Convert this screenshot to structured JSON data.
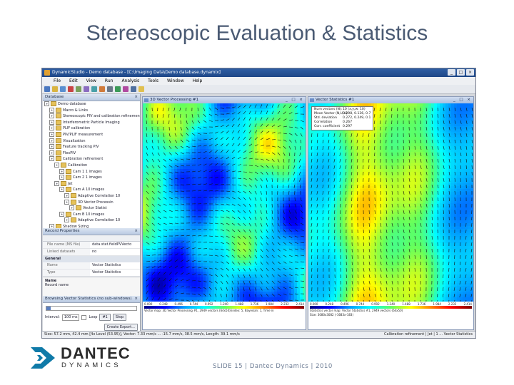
{
  "slide": {
    "title": "Stereoscopic Evaluation & Statistics",
    "footer": "SLIDE 15 | Dantec Dynamics | 2010"
  },
  "brand": {
    "line1": "DANTEC",
    "line2": "DYNAMICS",
    "color": "#0f7aa8"
  },
  "app": {
    "title": "DynamicStudio - Demo database - [C:\\Imaging Data\\Demo database.dynamix]",
    "window_buttons": [
      "_",
      "□",
      "×"
    ],
    "menu": [
      "File",
      "Edit",
      "View",
      "Run",
      "Analysis",
      "Tools",
      "Window",
      "Help"
    ],
    "database_panel": {
      "title": "Database",
      "close": "×",
      "tree": [
        {
          "label": "Demo database",
          "level": 0
        },
        {
          "label": "Macro & Links",
          "level": 1
        },
        {
          "label": "Stereoscopic PIV and calibration refinement",
          "level": 1
        },
        {
          "label": "Interferometric Particle Imaging",
          "level": 1
        },
        {
          "label": "PLIF calibration",
          "level": 1
        },
        {
          "label": "PIV/PLIF measurement",
          "level": 1
        },
        {
          "label": "Visualization",
          "level": 1
        },
        {
          "label": "Feature tracking PIV",
          "level": 1
        },
        {
          "label": "FlexPIV",
          "level": 1
        },
        {
          "label": "Calibration refinement",
          "level": 1
        },
        {
          "label": "Calibration",
          "level": 2
        },
        {
          "label": "Cam 1  1 images",
          "level": 3
        },
        {
          "label": "Cam 2  1 images",
          "level": 3
        },
        {
          "label": "Jet",
          "level": 2
        },
        {
          "label": "Cam A  10 images",
          "level": 3
        },
        {
          "label": "Adaptive Correlation 10",
          "level": 4
        },
        {
          "label": "3D Vector Processin",
          "level": 4
        },
        {
          "label": "Vector Statist",
          "level": 5
        },
        {
          "label": "Cam B  10 images",
          "level": 3
        },
        {
          "label": "Adaptive Correlation 10",
          "level": 4
        },
        {
          "label": "Shadow Sizing",
          "level": 1
        },
        {
          "label": "LIF",
          "level": 1
        }
      ]
    },
    "record_properties": {
      "title": "Record Properties",
      "rows": [
        {
          "key": "File name (MS file)",
          "value": "data.stat.fieldPVVecto"
        },
        {
          "key": "Linked datasets",
          "value": "no"
        }
      ],
      "category": "General",
      "rows2": [
        {
          "key": "Name",
          "value": "Vector Statistics"
        },
        {
          "key": "Type",
          "value": "Vector Statistics"
        }
      ],
      "desc_title": "Name",
      "desc_text": "Record name"
    },
    "processing": {
      "title": "Browsing Vector Statistics (no sub-windows)",
      "interval_label": "Interval:",
      "interval_value": "100 ms",
      "loop_label": "Loop",
      "stop_label": "Stop",
      "play_label": "#1",
      "export_label": "Create Export..."
    },
    "window1": {
      "title": "3D Vector Processing #1",
      "buttons": "_ □ ×",
      "legend_ticks": [
        "0.000",
        "0.124",
        "0.248",
        "0.372",
        "0.496",
        "0.620",
        "0.744",
        "0.868",
        "0.992",
        "1.116",
        "1.240",
        "1.364",
        "1.488",
        "1.612",
        "1.736",
        "1.860",
        "1.984",
        "2.108",
        "2.232",
        "2.356",
        "2.414"
      ],
      "caption": "Vector map: 3D Vector Processing #1, 2949 vectors (64x50)(index: 5, Bayesian: 1, Time in"
    },
    "window2": {
      "title": "Vector Statistics #1",
      "buttons": "_ □ ×",
      "stats": [
        {
          "k": "Num vectors (N):",
          "v": "10  (x,y,w: 10)"
        },
        {
          "k": "Mean Vector (N,U,V):",
          "v": "0.298, 0.136, 0.7"
        },
        {
          "k": "Std. deviation",
          "v": "0.272, 0.249, 0.1"
        },
        {
          "k": "Correlation",
          "v": "0.267"
        },
        {
          "k": "Corr. coefficient",
          "v": "0.297"
        }
      ],
      "legend_ticks": [
        "0.000",
        "0.124",
        "0.248",
        "0.372",
        "0.496",
        "0.620",
        "0.744",
        "0.868",
        "0.992",
        "1.116",
        "1.240",
        "1.364",
        "1.488",
        "1.612",
        "1.736",
        "1.860",
        "1.984",
        "2.108",
        "2.232",
        "2.356",
        "2.414"
      ],
      "caption": "Statistics vector map: Vector Statistics #1, 2949 vectors (64x50)",
      "caption2": "Size: 3080x3082 (-1683x-183)"
    },
    "status_left": "Size: 57.2 mm, 42.4 mm [4x Level (53.95)], Vector: 7.33 mm/s ... -15.7 mm/s, 38.5 mm/s, Length: 39.1 mm/s",
    "status_right": "Calibration refinement | Jet | 1 ... Vector Statistics"
  }
}
